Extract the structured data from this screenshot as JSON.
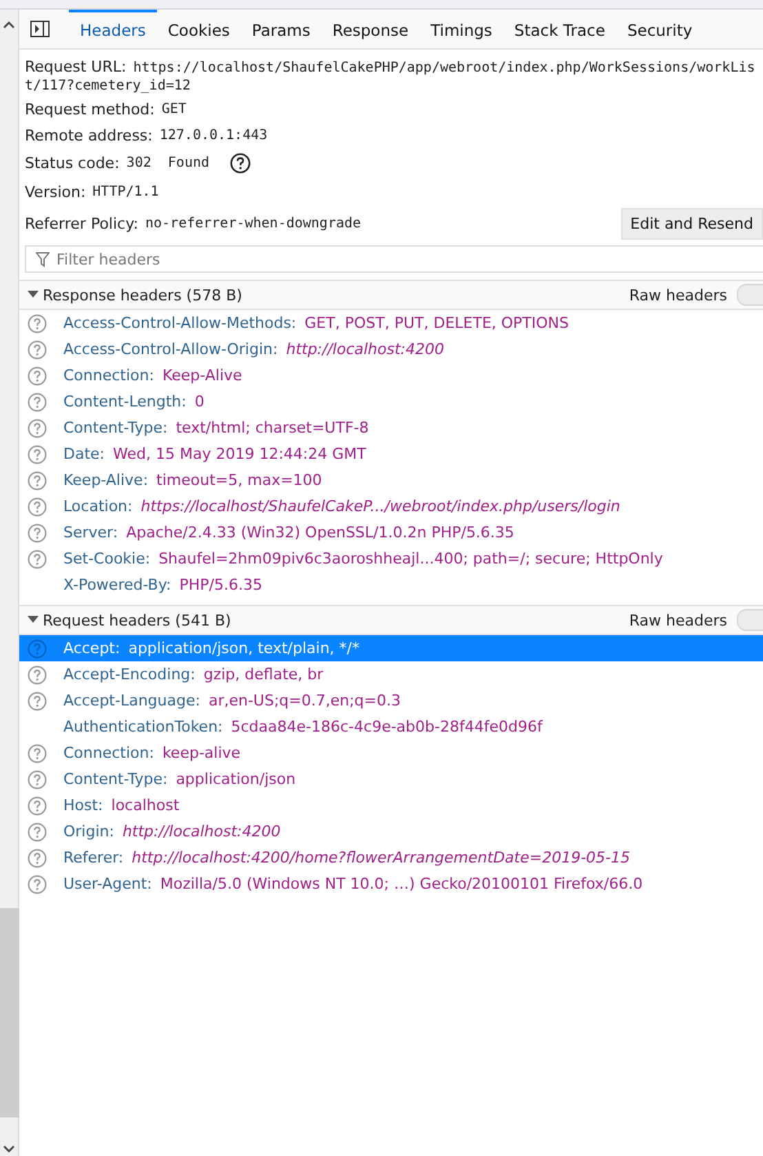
{
  "tabs": [
    {
      "label": "Headers",
      "selected": true
    },
    {
      "label": "Cookies",
      "selected": false
    },
    {
      "label": "Params",
      "selected": false
    },
    {
      "label": "Response",
      "selected": false
    },
    {
      "label": "Timings",
      "selected": false
    },
    {
      "label": "Stack Trace",
      "selected": false
    },
    {
      "label": "Security",
      "selected": false
    }
  ],
  "summary": [
    {
      "label": "Request URL:",
      "value": "https://localhost/ShaufelCakePHP/app/webroot/index.php/WorkSessions/workList/117?cemetery_id=12"
    },
    {
      "label": "Request method:",
      "value": "GET"
    },
    {
      "label": "Remote address:",
      "value": "127.0.0.1:443"
    },
    {
      "label": "Status code:",
      "value": "302  Found",
      "help": true
    },
    {
      "label": "Version:",
      "value": "HTTP/1.1"
    },
    {
      "label": "Referrer Policy:",
      "value": "no-referrer-when-downgrade"
    }
  ],
  "resend_button": "Edit and Resend",
  "filter": {
    "placeholder": "Filter headers"
  },
  "sections": [
    {
      "title": "Response headers (578 B)",
      "expanded": true,
      "raw_label": "Raw headers",
      "raw_on": false,
      "rows": [
        {
          "name": "Access-Control-Allow-Methods:",
          "value": "GET, POST, PUT, DELETE, OPTIONS",
          "kind": "text",
          "help": true,
          "selected": false
        },
        {
          "name": "Access-Control-Allow-Origin:",
          "value": "http://localhost:4200",
          "kind": "url",
          "help": true,
          "selected": false
        },
        {
          "name": "Connection:",
          "value": "Keep-Alive",
          "kind": "text",
          "help": true,
          "selected": false
        },
        {
          "name": "Content-Length:",
          "value": "0",
          "kind": "text",
          "help": true,
          "selected": false
        },
        {
          "name": "Content-Type:",
          "value": "text/html; charset=UTF-8",
          "kind": "text",
          "help": true,
          "selected": false
        },
        {
          "name": "Date:",
          "value": "Wed, 15 May 2019 12:44:24 GMT",
          "kind": "text",
          "help": true,
          "selected": false
        },
        {
          "name": "Keep-Alive:",
          "value": "timeout=5, max=100",
          "kind": "text",
          "help": true,
          "selected": false
        },
        {
          "name": "Location:",
          "value": "https://localhost/ShaufelCakeP.../webroot/index.php/users/login",
          "kind": "url",
          "help": true,
          "selected": false
        },
        {
          "name": "Server:",
          "value": "Apache/2.4.33 (Win32) OpenSSL/1.0.2n PHP/5.6.35",
          "kind": "text",
          "help": true,
          "selected": false
        },
        {
          "name": "Set-Cookie:",
          "value": "Shaufel=2hm09piv6c3aoroshheajl...400; path=/; secure; HttpOnly",
          "kind": "text",
          "help": true,
          "selected": false
        },
        {
          "name": "X-Powered-By:",
          "value": "PHP/5.6.35",
          "kind": "text",
          "help": false,
          "selected": false
        }
      ]
    },
    {
      "title": "Request headers (541 B)",
      "expanded": true,
      "raw_label": "Raw headers",
      "raw_on": false,
      "rows": [
        {
          "name": "Accept:",
          "value": "application/json, text/plain, */*",
          "kind": "text",
          "help": true,
          "selected": true
        },
        {
          "name": "Accept-Encoding:",
          "value": "gzip, deflate, br",
          "kind": "text",
          "help": true,
          "selected": false
        },
        {
          "name": "Accept-Language:",
          "value": "ar,en-US;q=0.7,en;q=0.3",
          "kind": "text",
          "help": true,
          "selected": false
        },
        {
          "name": "AuthenticationToken:",
          "value": "5cdaa84e-186c-4c9e-ab0b-28f44fe0d96f",
          "kind": "text",
          "help": false,
          "selected": false
        },
        {
          "name": "Connection:",
          "value": "keep-alive",
          "kind": "text",
          "help": true,
          "selected": false
        },
        {
          "name": "Content-Type:",
          "value": "application/json",
          "kind": "text",
          "help": true,
          "selected": false
        },
        {
          "name": "Host:",
          "value": "localhost",
          "kind": "text",
          "help": true,
          "selected": false
        },
        {
          "name": "Origin:",
          "value": "http://localhost:4200",
          "kind": "url",
          "help": true,
          "selected": false
        },
        {
          "name": "Referer:",
          "value": "http://localhost:4200/home?flowerArrangementDate=2019-05-15",
          "kind": "url",
          "help": true,
          "selected": false
        },
        {
          "name": "User-Agent:",
          "value": "Mozilla/5.0 (Windows NT 10.0; …) Gecko/20100101 Firefox/66.0",
          "kind": "text",
          "help": true,
          "selected": false
        }
      ]
    }
  ]
}
